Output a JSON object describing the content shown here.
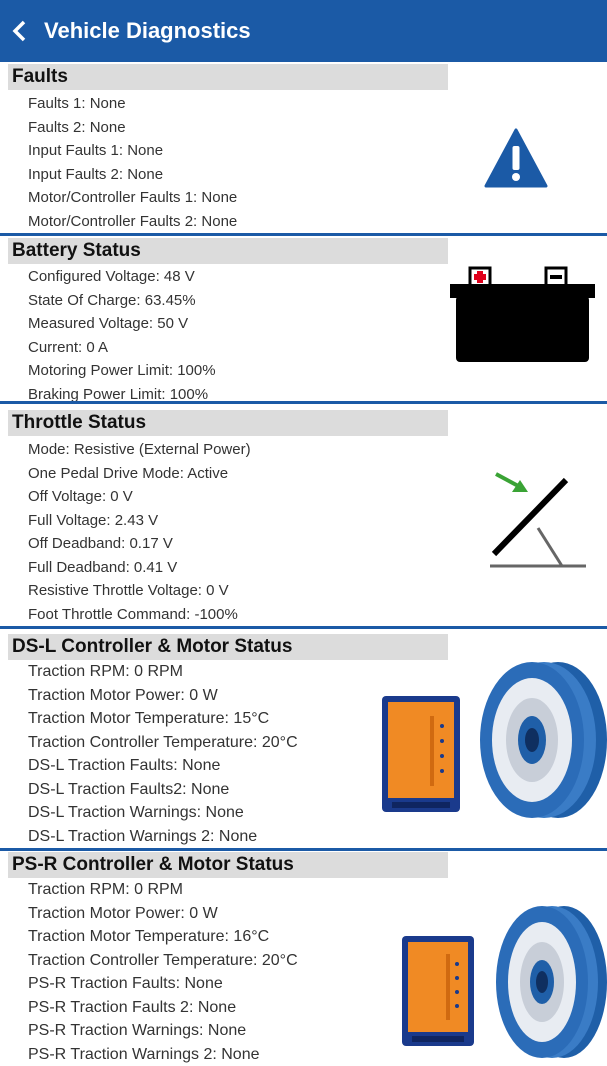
{
  "header": {
    "title": "Vehicle Diagnostics",
    "back_icon": "chevron-left-icon"
  },
  "colors": {
    "header": "#1b5aa6",
    "section_header": "#dcdcdc",
    "accent_green": "#3aa335",
    "battery_plus": "#e0001b"
  },
  "sections": [
    {
      "title": "Faults",
      "icon": "warning-icon",
      "lines": [
        "Faults 1: None",
        "Faults 2: None",
        "Input Faults 1: None",
        "Input Faults 2: None",
        "Motor/Controller Faults 1: None",
        "Motor/Controller Faults 2: None"
      ]
    },
    {
      "title": "Battery Status",
      "icon": "battery-icon",
      "lines": [
        "Configured Voltage: 48 V",
        "State Of Charge: 63.45%",
        "Measured Voltage: 50 V",
        "Current: 0 A",
        "Motoring Power Limit: 100%",
        "Braking Power Limit: 100%"
      ]
    },
    {
      "title": "Throttle Status",
      "icon": "pedal-icon",
      "lines": [
        "Mode: Resistive (External Power)",
        "One Pedal Drive Mode: Active",
        "Off Voltage: 0 V",
        "Full Voltage: 2.43 V",
        "Off Deadband: 0.17 V",
        "Full Deadband: 0.41 V",
        "Resistive Throttle Voltage: 0 V",
        "Foot Throttle Command: -100%"
      ]
    },
    {
      "title": "DS-L Controller & Motor Status",
      "icon": "controller-motor-icon",
      "lines": [
        "Traction RPM: 0 RPM",
        "Traction Motor Power: 0 W",
        "Traction Motor Temperature: 15°C",
        "Traction Controller Temperature: 20°C",
        "DS-L Traction Faults: None",
        "DS-L Traction Faults2: None",
        "DS-L Traction Warnings: None",
        "DS-L Traction Warnings 2: None"
      ]
    },
    {
      "title": "PS-R Controller & Motor Status",
      "icon": "controller-motor-icon",
      "lines": [
        "Traction RPM: 0 RPM",
        "Traction Motor Power: 0 W",
        "Traction Motor Temperature: 16°C",
        "Traction Controller Temperature: 20°C",
        "PS-R Traction Faults: None",
        "PS-R Traction Faults 2: None",
        "PS-R Traction Warnings: None",
        "PS-R Traction Warnings 2: None"
      ]
    }
  ]
}
